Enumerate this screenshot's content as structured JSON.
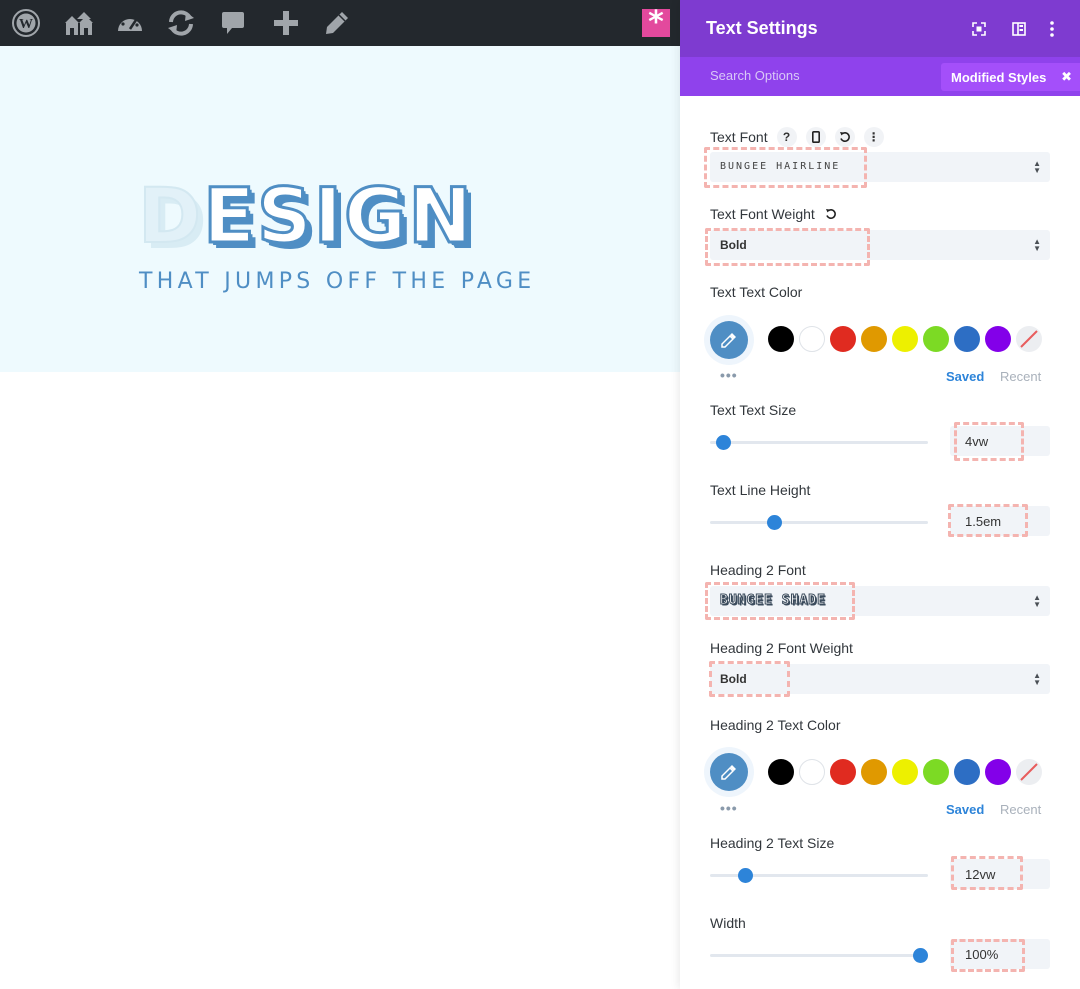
{
  "colors": {
    "admin_bar": "#23282d",
    "panel_header": "#7e3bd0",
    "panel_subheader": "#8f42ec",
    "modified_badge": "#a44ffa",
    "accent_blue": "#2d84d9",
    "hero_blue": "#4f8ec4",
    "preview_bg": "#eefafe",
    "pink_button": "#e3499d"
  },
  "admin_bar": {
    "icons": [
      "wordpress-icon",
      "my-sites-icon",
      "dashboard-icon",
      "updates-icon",
      "comments-icon",
      "new-content-icon",
      "edit-icon"
    ],
    "pink_button_glyph": "*"
  },
  "preview": {
    "title_first": "D",
    "title_rest": "ESIGN",
    "subtitle": "THAT JUMPS OFF THE PAGE"
  },
  "panel": {
    "title": "Text Settings",
    "header_icons": [
      "expand-icon",
      "split-view-icon",
      "more-icon"
    ],
    "search_placeholder": "Search Options",
    "modified_styles_label": "Modified Styles",
    "modified_styles_close": "✖"
  },
  "settings": {
    "text_font": {
      "label": "Text Font",
      "value": "BUNGEE HAIRLINE"
    },
    "text_font_weight": {
      "label": "Text Font Weight",
      "value": "Bold"
    },
    "text_color": {
      "label": "Text Text Color",
      "saved": "Saved",
      "recent": "Recent",
      "dots": "•••"
    },
    "text_size": {
      "label": "Text Text Size",
      "value": "4vw",
      "slider_fraction": 0.03
    },
    "line_height": {
      "label": "Text Line Height",
      "value": "1.5em",
      "slider_fraction": 0.28
    },
    "h2_font": {
      "label": "Heading 2 Font",
      "value": "BUNGEE SHADE"
    },
    "h2_font_weight": {
      "label": "Heading 2 Font Weight",
      "value": "Bold"
    },
    "h2_color": {
      "label": "Heading 2 Text Color",
      "saved": "Saved",
      "recent": "Recent",
      "dots": "•••"
    },
    "h2_size": {
      "label": "Heading 2 Text Size",
      "value": "12vw",
      "slider_fraction": 0.14
    },
    "width": {
      "label": "Width",
      "value": "100%",
      "slider_fraction": 1.0
    }
  },
  "swatches": [
    "#000000",
    "#ffffff",
    "#e02b20",
    "#e09900",
    "#edf000",
    "#7cda24",
    "#2d6ec4",
    "#8300e9"
  ],
  "help_glyph": "?",
  "more_glyph": "⋮"
}
